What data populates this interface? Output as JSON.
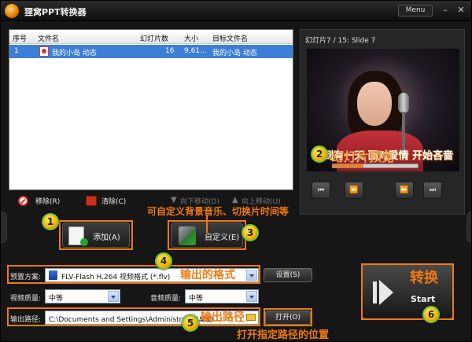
{
  "app": {
    "title": "狸窝PPT转换器",
    "menu_label": "Menu",
    "minimize": "–",
    "close": "✕"
  },
  "file_list": {
    "columns": [
      "序号",
      "文件名",
      "幻灯片数",
      "大小",
      "目标文件名"
    ],
    "rows": [
      {
        "index": "1",
        "filename": "我的小岛 动态",
        "slides": "16",
        "size": "9,61...",
        "target": "我的小岛 动态"
      }
    ]
  },
  "list_actions": {
    "remove": "移除(R)",
    "clear": "清除(C)",
    "move_down": "向下移动(D)",
    "move_up": "向上移动(U)"
  },
  "preview": {
    "slide_info": "幻灯片7 / 15: Slide 7",
    "lyric": "直到有一天 面对爱情 开始吝啬",
    "seek_progress": 0.36,
    "controls": [
      "⏮",
      "⏪",
      "⏩",
      "⏭"
    ]
  },
  "buttons": {
    "add": "添加(A)",
    "customize": "自定义(E)",
    "convert": "Start",
    "settings": "设置(S)",
    "open": "打开(O)"
  },
  "settings": {
    "preset_label": "预置方案:",
    "preset_value": "FLV-Flash H.264 视频格式 (*.flv)",
    "video_quality_label": "视频质量:",
    "video_quality_value": "中等",
    "audio_quality_label": "音频质量:",
    "audio_quality_value": "中等",
    "output_label": "输出路径:",
    "output_value": "C:\\Documents and Settings\\Administrator\\桌面"
  },
  "annotations": {
    "badges": [
      "1",
      "2",
      "3",
      "4",
      "5",
      "6"
    ],
    "custom_tip": "可自定义背景音乐、切换片时间等",
    "preview_tip": "幻灯片预览",
    "format_tip": "输出的格式",
    "path_tip": "输出路径",
    "open_tip": "打开指定路径的位置",
    "convert_tip": "转换"
  },
  "colors": {
    "accent": "#f07a10",
    "selection": "#3d7fd6",
    "window_bg": "#161616"
  }
}
